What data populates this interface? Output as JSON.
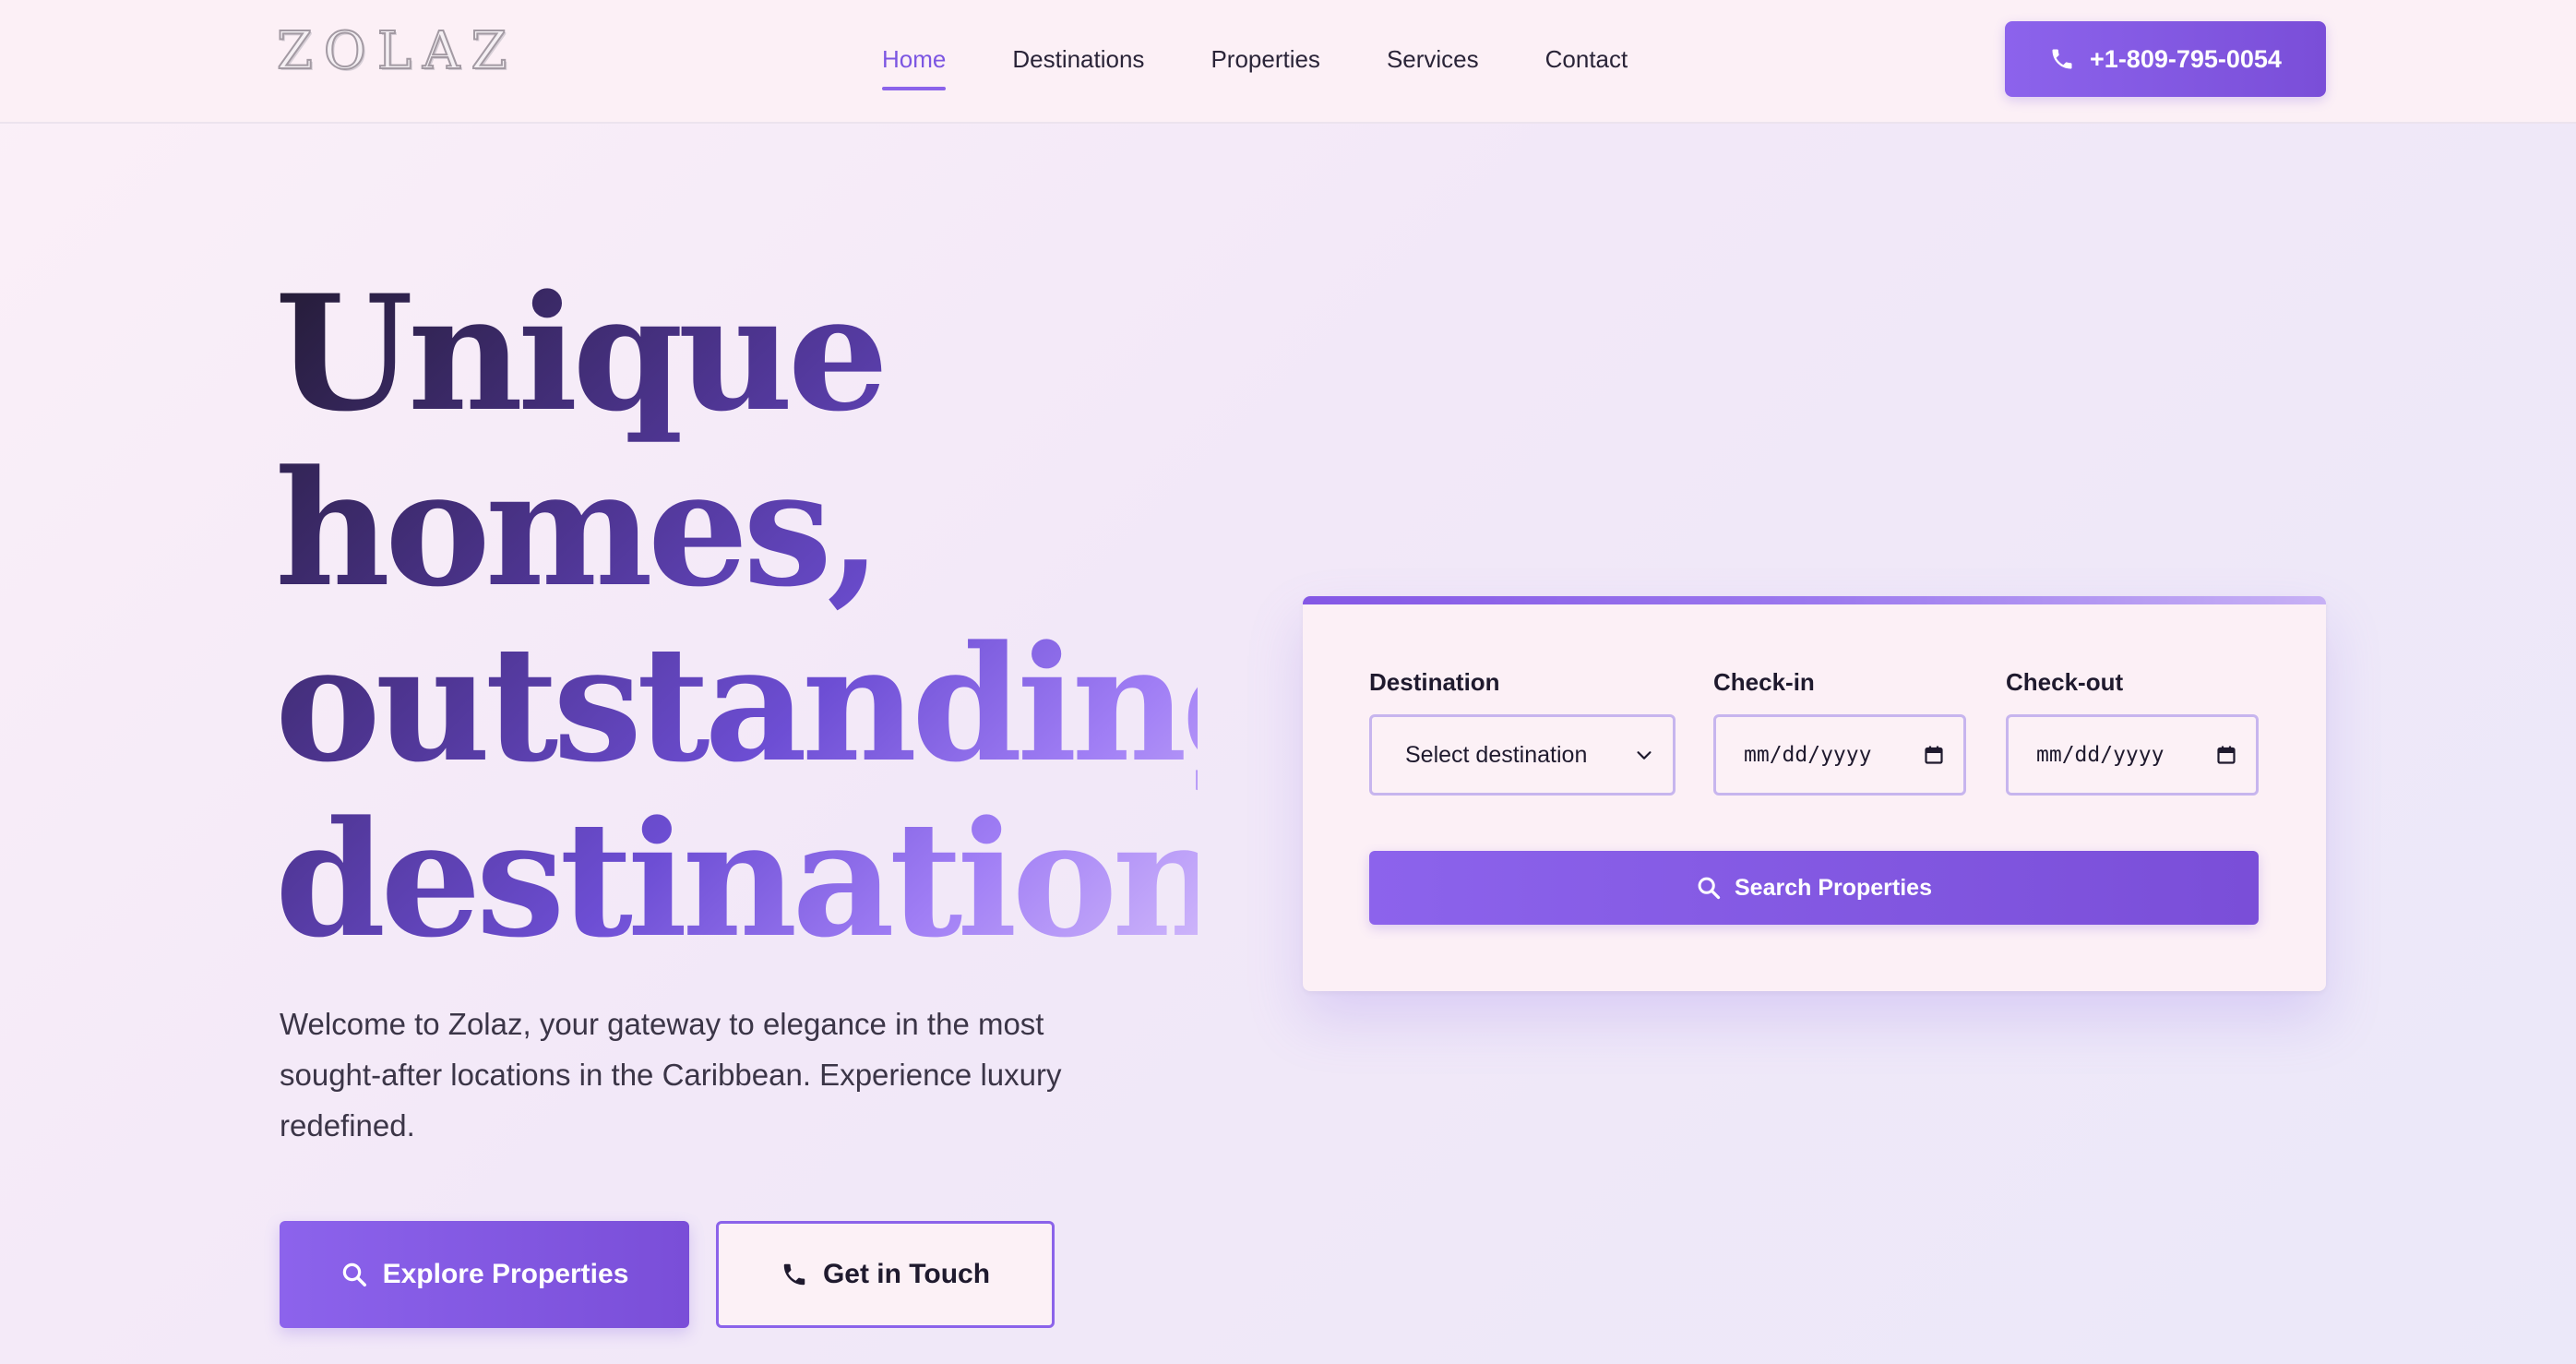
{
  "header": {
    "logo": "ZOLAZ",
    "nav": [
      {
        "label": "Home",
        "active": true
      },
      {
        "label": "Destinations"
      },
      {
        "label": "Properties"
      },
      {
        "label": "Services"
      },
      {
        "label": "Contact"
      }
    ],
    "phone": "+1-809-795-0054",
    "phone_icon": "phone-icon"
  },
  "hero": {
    "title_lines": [
      "Unique",
      "homes,",
      "outstanding",
      "destinations"
    ],
    "description": "Welcome to Zolaz, your gateway to elegance in the most sought-after locations in the Caribbean. Experience luxury redefined.",
    "primary_button": {
      "label": "Explore Properties",
      "icon": "search-icon"
    },
    "secondary_button": {
      "label": "Get in Touch",
      "icon": "phone-icon"
    }
  },
  "search": {
    "destination_label": "Destination",
    "destination_value": "Select destination",
    "checkin_label": "Check-in",
    "checkin_placeholder": "mm/dd/yyyy",
    "checkout_label": "Check-out",
    "checkout_placeholder": "mm/dd/yyyy",
    "button_label": "Search Properties",
    "button_icon": "search-icon"
  },
  "colors": {
    "accent": "#7c56e2",
    "accent_dark": "#7a4ed8",
    "background": "#fcf0f6",
    "text": "#1f1a2e"
  }
}
